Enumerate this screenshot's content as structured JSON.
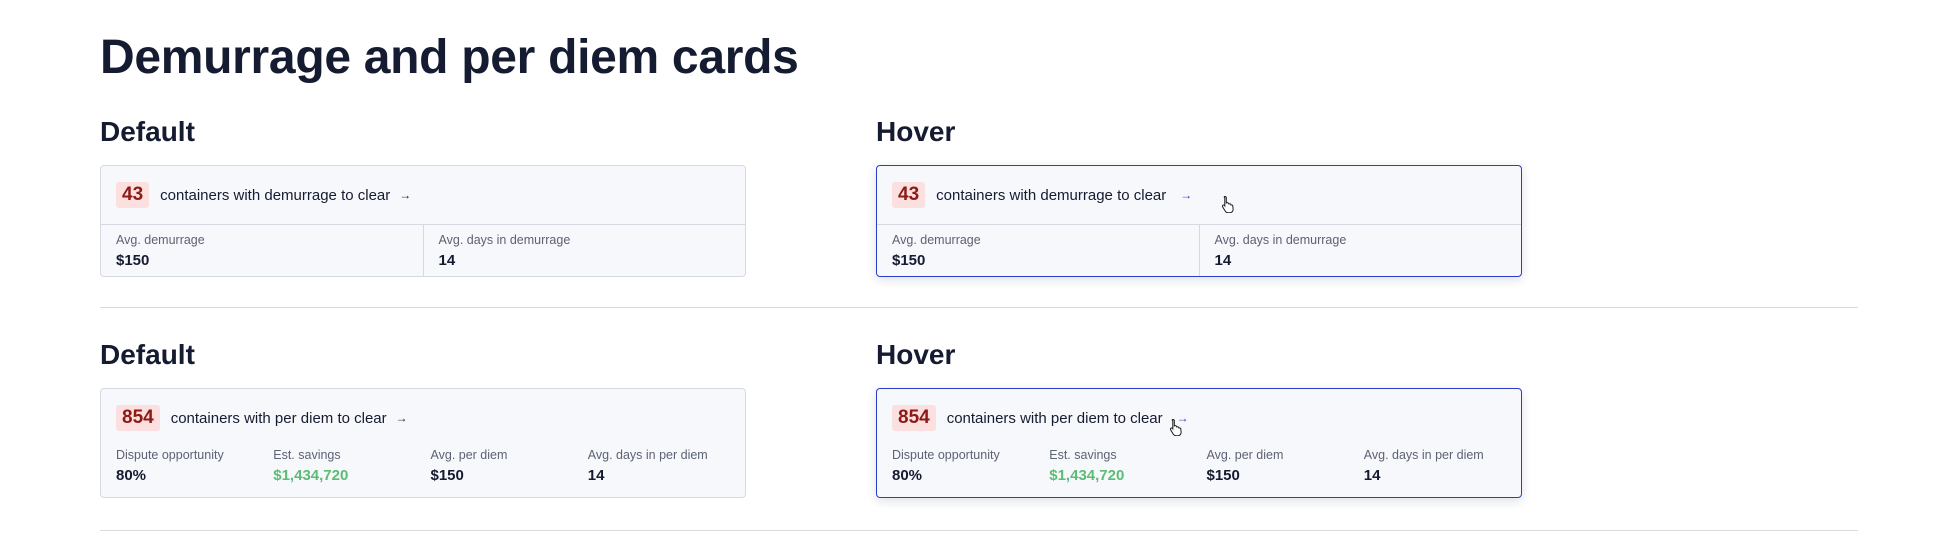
{
  "page_title": "Demurrage and per diem cards",
  "rows": [
    {
      "default_label": "Default",
      "hover_label": "Hover",
      "card": {
        "count": "43",
        "text": "containers with demurrage to clear",
        "arrow_icon": "→",
        "stats": [
          {
            "label": "Avg. demurrage",
            "value": "$150"
          },
          {
            "label": "Avg. days in demurrage",
            "value": "14"
          }
        ]
      }
    },
    {
      "default_label": "Default",
      "hover_label": "Hover",
      "card": {
        "count": "854",
        "text": "containers with per diem to clear",
        "arrow_icon": "→",
        "stats": [
          {
            "label": "Dispute opportunity",
            "value": "80%"
          },
          {
            "label": "Est. savings",
            "value": "$1,434,720"
          },
          {
            "label": "Avg. per diem",
            "value": "$150"
          },
          {
            "label": "Avg. days in per diem",
            "value": "14"
          }
        ]
      }
    }
  ],
  "colors": {
    "hover_border": "#2840c9",
    "badge_bg": "#fbe0df",
    "badge_text": "#8e1a16",
    "savings_green": "#5bbd73"
  },
  "icons": {
    "arrow": "arrow-right-icon",
    "cursor": "hand-pointer-cursor-icon"
  }
}
